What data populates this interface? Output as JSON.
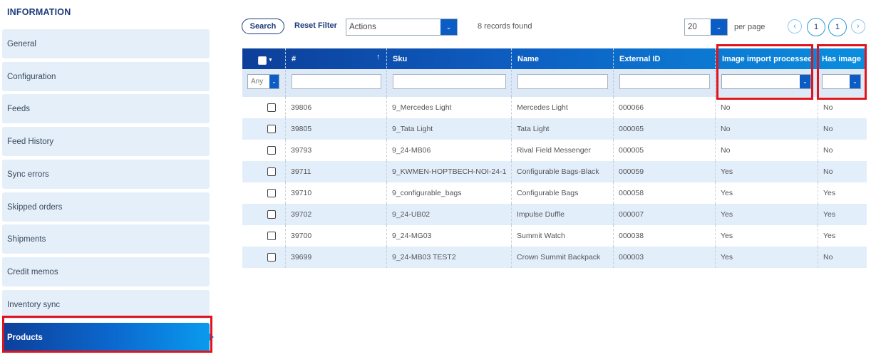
{
  "sidebar": {
    "title": "INFORMATION",
    "items": [
      {
        "label": "General"
      },
      {
        "label": "Configuration"
      },
      {
        "label": "Feeds"
      },
      {
        "label": "Feed History"
      },
      {
        "label": "Sync errors"
      },
      {
        "label": "Skipped orders"
      },
      {
        "label": "Shipments"
      },
      {
        "label": "Credit memos"
      },
      {
        "label": "Inventory sync"
      },
      {
        "label": "Products",
        "active": true
      }
    ]
  },
  "toolbar": {
    "search_label": "Search",
    "reset_label": "Reset Filter",
    "actions_value": "Actions",
    "records_text": "8 records found",
    "page_size_value": "20",
    "per_page_label": "per page",
    "current_page": "1",
    "total_pages": "1"
  },
  "grid": {
    "columns": [
      "#",
      "Sku",
      "Name",
      "External ID",
      "Image import processed",
      "Has image"
    ],
    "filter_any": "Any",
    "rows": [
      {
        "id": "39806",
        "sku": "9_Mercedes Light",
        "name": "Mercedes Light",
        "external_id": "000066",
        "image_processed": "No",
        "has_image": "No"
      },
      {
        "id": "39805",
        "sku": "9_Tata Light",
        "name": "Tata Light",
        "external_id": "000065",
        "image_processed": "No",
        "has_image": "No"
      },
      {
        "id": "39793",
        "sku": "9_24-MB06",
        "name": "Rival Field Messenger",
        "external_id": "000005",
        "image_processed": "No",
        "has_image": "No"
      },
      {
        "id": "39711",
        "sku": "9_KWMEN-HOPTBECH-NOI-24-1",
        "name": "Configurable Bags-Black",
        "external_id": "000059",
        "image_processed": "Yes",
        "has_image": "No"
      },
      {
        "id": "39710",
        "sku": "9_configurable_bags",
        "name": "Configurable Bags",
        "external_id": "000058",
        "image_processed": "Yes",
        "has_image": "Yes"
      },
      {
        "id": "39702",
        "sku": "9_24-UB02",
        "name": "Impulse Duffle",
        "external_id": "000007",
        "image_processed": "Yes",
        "has_image": "Yes"
      },
      {
        "id": "39700",
        "sku": "9_24-MG03",
        "name": "Summit Watch",
        "external_id": "000038",
        "image_processed": "Yes",
        "has_image": "Yes"
      },
      {
        "id": "39699",
        "sku": "9_24-MB03 TEST2",
        "name": "Crown Summit Backpack",
        "external_id": "000003",
        "image_processed": "Yes",
        "has_image": "No"
      }
    ]
  },
  "colors": {
    "brand_dark": "#0d3f9a",
    "brand_light": "#0a8ee0",
    "highlight": "#e0141e",
    "row_alt": "#e3eefb"
  }
}
